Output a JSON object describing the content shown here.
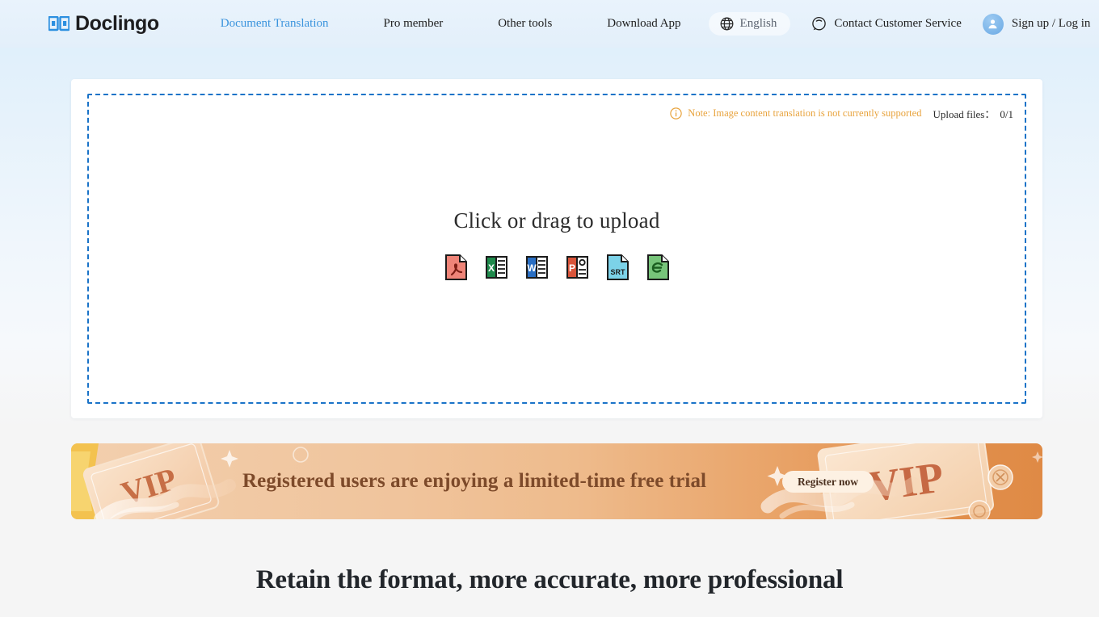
{
  "brand": {
    "name": "Doclingo",
    "logo_icon": "book-logo-icon",
    "accent_color": "#1a73c8"
  },
  "header": {
    "nav": [
      {
        "label": "Document Translation",
        "active": true
      },
      {
        "label": "Pro member",
        "active": false
      },
      {
        "label": "Other tools",
        "active": false
      },
      {
        "label": "Download App",
        "active": false
      }
    ],
    "language": {
      "label": "English",
      "icon": "globe-icon"
    },
    "customer_service": {
      "label": "Contact Customer Service",
      "icon": "chat-bubble-icon"
    },
    "account": {
      "label": "Sign up / Log in",
      "icon": "user-avatar-icon"
    }
  },
  "upload": {
    "notice": {
      "icon": "info-circle-icon",
      "text": "Note: Image content translation is not currently supported",
      "color": "#e8a33d"
    },
    "files_label": "Upload files：",
    "files_count": "0/1",
    "dropzone_title": "Click or drag to upload",
    "file_types": [
      {
        "name": "pdf-file-icon",
        "label": "PDF",
        "color": "#e8695c"
      },
      {
        "name": "excel-file-icon",
        "label": "X",
        "color": "#1f8a4c"
      },
      {
        "name": "word-file-icon",
        "label": "W",
        "color": "#2a6fc4"
      },
      {
        "name": "powerpoint-file-icon",
        "label": "P",
        "color": "#d9553b"
      },
      {
        "name": "srt-file-icon",
        "label": "SRT",
        "color": "#5ec9e8"
      },
      {
        "name": "epub-file-icon",
        "label": "e",
        "color": "#67bd6a"
      }
    ]
  },
  "promo": {
    "text": "Registered users are enjoying a limited-time free trial",
    "button_label": "Register now",
    "badge_text": "VIP",
    "text_color": "#7d4a2a",
    "gradient_from": "#f3cfae",
    "gradient_to": "#df8a45"
  },
  "section": {
    "heading": "Retain the format, more accurate, more professional"
  }
}
